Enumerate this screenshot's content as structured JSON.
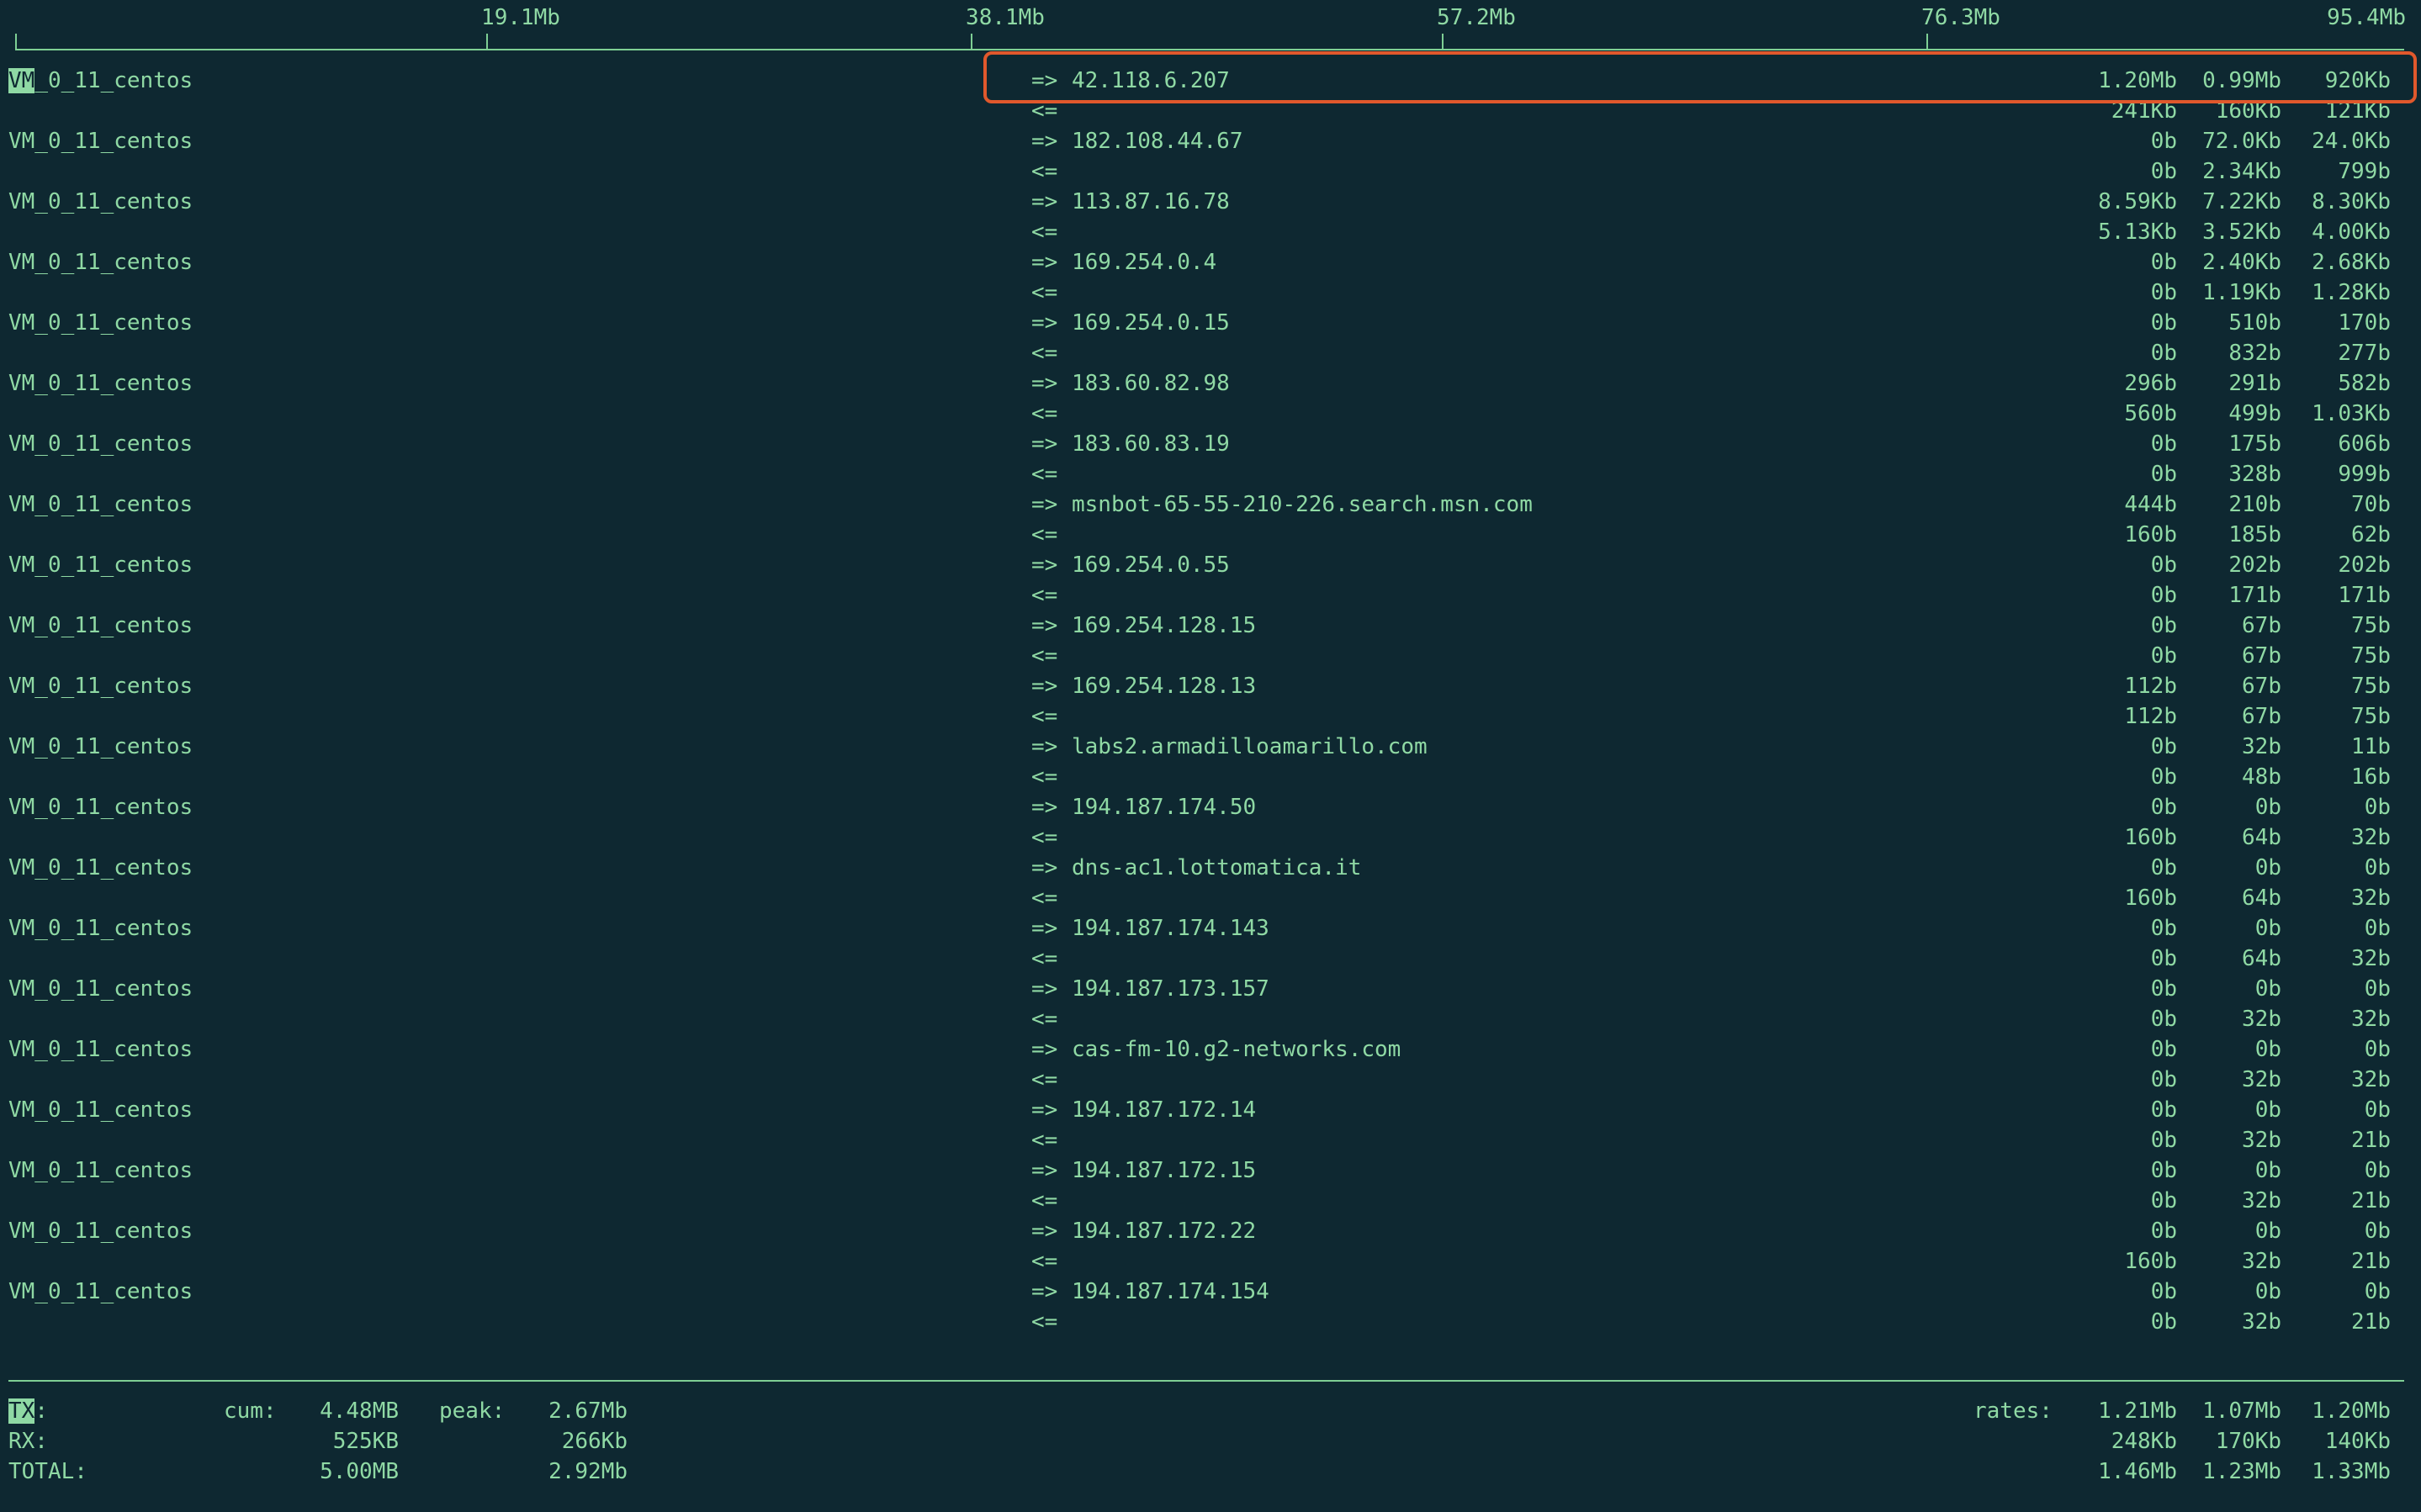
{
  "scale": {
    "labels": [
      "19.1Mb",
      "38.1Mb",
      "57.2Mb",
      "76.3Mb",
      "95.4Mb"
    ]
  },
  "tx_arrow": "=>",
  "rx_arrow": "<=",
  "connections": [
    {
      "host": "VM_0_11_centos",
      "peer": "42.118.6.207",
      "tx": [
        "1.20Mb",
        "0.99Mb",
        "920Kb"
      ],
      "rx": [
        "241Kb",
        "160Kb",
        "121Kb"
      ]
    },
    {
      "host": "VM_0_11_centos",
      "peer": "182.108.44.67",
      "tx": [
        "0b",
        "72.0Kb",
        "24.0Kb"
      ],
      "rx": [
        "0b",
        "2.34Kb",
        "799b"
      ]
    },
    {
      "host": "VM_0_11_centos",
      "peer": "113.87.16.78",
      "tx": [
        "8.59Kb",
        "7.22Kb",
        "8.30Kb"
      ],
      "rx": [
        "5.13Kb",
        "3.52Kb",
        "4.00Kb"
      ]
    },
    {
      "host": "VM_0_11_centos",
      "peer": "169.254.0.4",
      "tx": [
        "0b",
        "2.40Kb",
        "2.68Kb"
      ],
      "rx": [
        "0b",
        "1.19Kb",
        "1.28Kb"
      ]
    },
    {
      "host": "VM_0_11_centos",
      "peer": "169.254.0.15",
      "tx": [
        "0b",
        "510b",
        "170b"
      ],
      "rx": [
        "0b",
        "832b",
        "277b"
      ]
    },
    {
      "host": "VM_0_11_centos",
      "peer": "183.60.82.98",
      "tx": [
        "296b",
        "291b",
        "582b"
      ],
      "rx": [
        "560b",
        "499b",
        "1.03Kb"
      ]
    },
    {
      "host": "VM_0_11_centos",
      "peer": "183.60.83.19",
      "tx": [
        "0b",
        "175b",
        "606b"
      ],
      "rx": [
        "0b",
        "328b",
        "999b"
      ]
    },
    {
      "host": "VM_0_11_centos",
      "peer": "msnbot-65-55-210-226.search.msn.com",
      "tx": [
        "444b",
        "210b",
        "70b"
      ],
      "rx": [
        "160b",
        "185b",
        "62b"
      ]
    },
    {
      "host": "VM_0_11_centos",
      "peer": "169.254.0.55",
      "tx": [
        "0b",
        "202b",
        "202b"
      ],
      "rx": [
        "0b",
        "171b",
        "171b"
      ]
    },
    {
      "host": "VM_0_11_centos",
      "peer": "169.254.128.15",
      "tx": [
        "0b",
        "67b",
        "75b"
      ],
      "rx": [
        "0b",
        "67b",
        "75b"
      ]
    },
    {
      "host": "VM_0_11_centos",
      "peer": "169.254.128.13",
      "tx": [
        "112b",
        "67b",
        "75b"
      ],
      "rx": [
        "112b",
        "67b",
        "75b"
      ]
    },
    {
      "host": "VM_0_11_centos",
      "peer": "labs2.armadilloamarillo.com",
      "tx": [
        "0b",
        "32b",
        "11b"
      ],
      "rx": [
        "0b",
        "48b",
        "16b"
      ]
    },
    {
      "host": "VM_0_11_centos",
      "peer": "194.187.174.50",
      "tx": [
        "0b",
        "0b",
        "0b"
      ],
      "rx": [
        "160b",
        "64b",
        "32b"
      ]
    },
    {
      "host": "VM_0_11_centos",
      "peer": "dns-ac1.lottomatica.it",
      "tx": [
        "0b",
        "0b",
        "0b"
      ],
      "rx": [
        "160b",
        "64b",
        "32b"
      ]
    },
    {
      "host": "VM_0_11_centos",
      "peer": "194.187.174.143",
      "tx": [
        "0b",
        "0b",
        "0b"
      ],
      "rx": [
        "0b",
        "64b",
        "32b"
      ]
    },
    {
      "host": "VM_0_11_centos",
      "peer": "194.187.173.157",
      "tx": [
        "0b",
        "0b",
        "0b"
      ],
      "rx": [
        "0b",
        "32b",
        "32b"
      ]
    },
    {
      "host": "VM_0_11_centos",
      "peer": "cas-fm-10.g2-networks.com",
      "tx": [
        "0b",
        "0b",
        "0b"
      ],
      "rx": [
        "0b",
        "32b",
        "32b"
      ]
    },
    {
      "host": "VM_0_11_centos",
      "peer": "194.187.172.14",
      "tx": [
        "0b",
        "0b",
        "0b"
      ],
      "rx": [
        "0b",
        "32b",
        "21b"
      ]
    },
    {
      "host": "VM_0_11_centos",
      "peer": "194.187.172.15",
      "tx": [
        "0b",
        "0b",
        "0b"
      ],
      "rx": [
        "0b",
        "32b",
        "21b"
      ]
    },
    {
      "host": "VM_0_11_centos",
      "peer": "194.187.172.22",
      "tx": [
        "0b",
        "0b",
        "0b"
      ],
      "rx": [
        "160b",
        "32b",
        "21b"
      ]
    },
    {
      "host": "VM_0_11_centos",
      "peer": "194.187.174.154",
      "tx": [
        "0b",
        "0b",
        "0b"
      ],
      "rx": [
        "0b",
        "32b",
        "21b"
      ]
    }
  ],
  "totals": {
    "tx": {
      "label": "TX",
      "sep": ":",
      "cum_label": "cum:",
      "cum": "4.48MB",
      "peak_label": "peak:",
      "peak": "2.67Mb",
      "rates_label": "rates:",
      "rates": [
        "1.21Mb",
        "1.07Mb",
        "1.20Mb"
      ]
    },
    "rx": {
      "label": "RX:",
      "cum": "525KB",
      "peak": "266Kb",
      "rates": [
        "248Kb",
        "170Kb",
        "140Kb"
      ]
    },
    "total": {
      "label": "TOTAL:",
      "cum": "5.00MB",
      "peak": "2.92Mb",
      "rates": [
        "1.46Mb",
        "1.23Mb",
        "1.33Mb"
      ]
    }
  },
  "colors": {
    "background": "#0e2831",
    "text": "#8fd9a4",
    "highlight_box": "#e0582c"
  }
}
